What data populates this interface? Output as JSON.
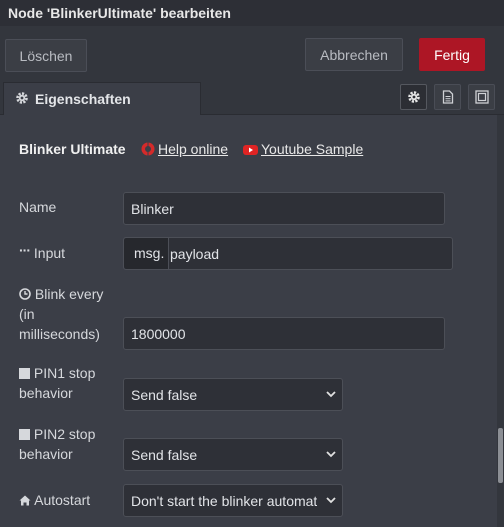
{
  "window": {
    "title": "Node 'BlinkerUltimate' bearbeiten"
  },
  "toolbar": {
    "delete_label": "Löschen",
    "cancel_label": "Abbrechen",
    "done_label": "Fertig"
  },
  "tabs": {
    "properties_label": "Eigenschaften"
  },
  "node": {
    "title": "Blinker Ultimate",
    "help_link": "Help online",
    "youtube_link": "Youtube Sample"
  },
  "form": {
    "name_label": "Name",
    "name_value": "Blinker",
    "input_label": "Input",
    "input_prefix": "msg.",
    "input_value": "payload",
    "blink_label_1": "Blink every",
    "blink_label_2": "(in",
    "blink_label_3": "milliseconds)",
    "blink_value": "1800000",
    "pin1_label_1": "PIN1 stop",
    "pin1_label_2": "behavior",
    "pin1_value": "Send false",
    "pin2_label_1": "PIN2 stop",
    "pin2_label_2": "behavior",
    "pin2_value": "Send false",
    "autostart_label": "Autostart",
    "autostart_value": "Don't start the blinker automat"
  },
  "colors": {
    "background": "#3b3e47",
    "primary_button": "#ad1625",
    "help_icon": "#d42a2a",
    "youtube_icon": "#e02424"
  }
}
